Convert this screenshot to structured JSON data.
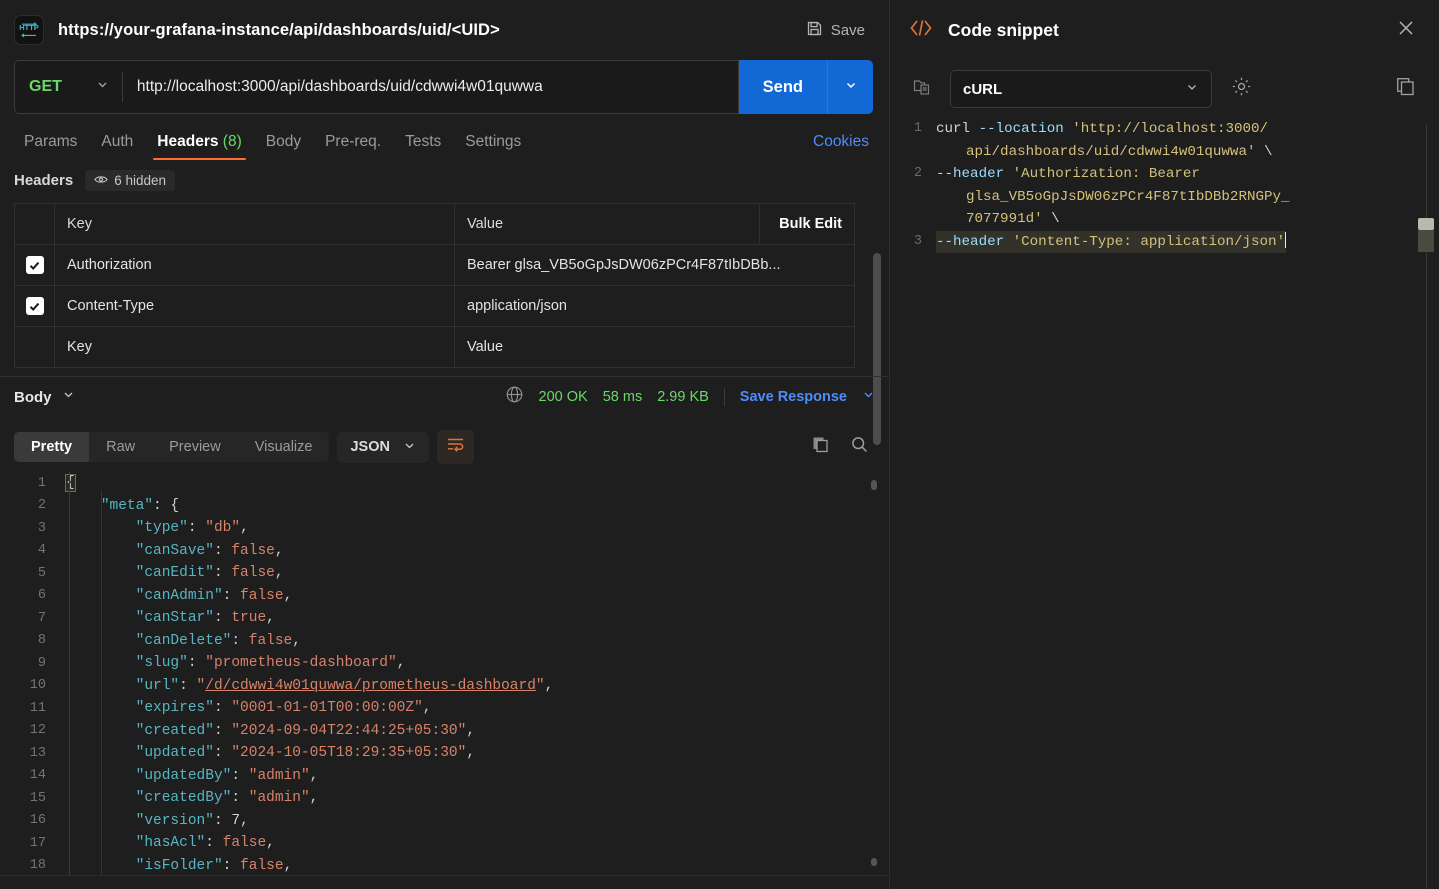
{
  "request": {
    "protocol_icon": "http-icon",
    "title": "https://your-grafana-instance/api/dashboards/uid/<UID>",
    "save_label": "Save",
    "method": "GET",
    "url": "http://localhost:3000/api/dashboards/uid/cdwwi4w01quwwa",
    "send_label": "Send"
  },
  "tabs": [
    {
      "label": "Params",
      "active": false
    },
    {
      "label": "Auth",
      "active": false
    },
    {
      "label": "Headers",
      "count": "(8)",
      "active": true
    },
    {
      "label": "Body",
      "active": false
    },
    {
      "label": "Pre-req.",
      "active": false
    },
    {
      "label": "Tests",
      "active": false
    },
    {
      "label": "Settings",
      "active": false
    }
  ],
  "cookies_label": "Cookies",
  "headers_section": {
    "label": "Headers",
    "hidden_label": "6 hidden",
    "columns": {
      "key": "Key",
      "value": "Value",
      "bulk_edit": "Bulk Edit"
    },
    "rows": [
      {
        "checked": true,
        "key": "Authorization",
        "value": "Bearer glsa_VB5oGpJsDW06zPCr4F87tIbDBb..."
      },
      {
        "checked": true,
        "key": "Content-Type",
        "value": "application/json"
      },
      {
        "checked": false,
        "key": "Key",
        "value": "Value",
        "placeholder": true
      }
    ]
  },
  "response": {
    "body_label": "Body",
    "status": "200 OK",
    "time": "58 ms",
    "size": "2.99 KB",
    "save_response_label": "Save Response",
    "view_tabs": [
      {
        "label": "Pretty",
        "active": true
      },
      {
        "label": "Raw",
        "active": false
      },
      {
        "label": "Preview",
        "active": false
      },
      {
        "label": "Visualize",
        "active": false
      }
    ],
    "format": "JSON",
    "json_lines": [
      {
        "n": "1",
        "segments": [
          {
            "t": "{",
            "c": "p",
            "box": true
          }
        ]
      },
      {
        "n": "2",
        "segments": [
          {
            "t": "    ",
            "c": "p"
          },
          {
            "t": "\"meta\"",
            "c": "k"
          },
          {
            "t": ": {",
            "c": "p"
          }
        ]
      },
      {
        "n": "3",
        "segments": [
          {
            "t": "        ",
            "c": "p"
          },
          {
            "t": "\"type\"",
            "c": "k"
          },
          {
            "t": ": ",
            "c": "p"
          },
          {
            "t": "\"db\"",
            "c": "s"
          },
          {
            "t": ",",
            "c": "p"
          }
        ]
      },
      {
        "n": "4",
        "segments": [
          {
            "t": "        ",
            "c": "p"
          },
          {
            "t": "\"canSave\"",
            "c": "k"
          },
          {
            "t": ": ",
            "c": "p"
          },
          {
            "t": "false",
            "c": "b"
          },
          {
            "t": ",",
            "c": "p"
          }
        ]
      },
      {
        "n": "5",
        "segments": [
          {
            "t": "        ",
            "c": "p"
          },
          {
            "t": "\"canEdit\"",
            "c": "k"
          },
          {
            "t": ": ",
            "c": "p"
          },
          {
            "t": "false",
            "c": "b"
          },
          {
            "t": ",",
            "c": "p"
          }
        ]
      },
      {
        "n": "6",
        "segments": [
          {
            "t": "        ",
            "c": "p"
          },
          {
            "t": "\"canAdmin\"",
            "c": "k"
          },
          {
            "t": ": ",
            "c": "p"
          },
          {
            "t": "false",
            "c": "b"
          },
          {
            "t": ",",
            "c": "p"
          }
        ]
      },
      {
        "n": "7",
        "segments": [
          {
            "t": "        ",
            "c": "p"
          },
          {
            "t": "\"canStar\"",
            "c": "k"
          },
          {
            "t": ": ",
            "c": "p"
          },
          {
            "t": "true",
            "c": "b"
          },
          {
            "t": ",",
            "c": "p"
          }
        ]
      },
      {
        "n": "8",
        "segments": [
          {
            "t": "        ",
            "c": "p"
          },
          {
            "t": "\"canDelete\"",
            "c": "k"
          },
          {
            "t": ": ",
            "c": "p"
          },
          {
            "t": "false",
            "c": "b"
          },
          {
            "t": ",",
            "c": "p"
          }
        ]
      },
      {
        "n": "9",
        "segments": [
          {
            "t": "        ",
            "c": "p"
          },
          {
            "t": "\"slug\"",
            "c": "k"
          },
          {
            "t": ": ",
            "c": "p"
          },
          {
            "t": "\"prometheus-dashboard\"",
            "c": "s"
          },
          {
            "t": ",",
            "c": "p"
          }
        ]
      },
      {
        "n": "10",
        "segments": [
          {
            "t": "        ",
            "c": "p"
          },
          {
            "t": "\"url\"",
            "c": "k"
          },
          {
            "t": ": ",
            "c": "p"
          },
          {
            "t": "\"",
            "c": "s"
          },
          {
            "t": "/d/cdwwi4w01quwwa/prometheus-dashboard",
            "c": "ulink"
          },
          {
            "t": "\"",
            "c": "s"
          },
          {
            "t": ",",
            "c": "p"
          }
        ]
      },
      {
        "n": "11",
        "segments": [
          {
            "t": "        ",
            "c": "p"
          },
          {
            "t": "\"expires\"",
            "c": "k"
          },
          {
            "t": ": ",
            "c": "p"
          },
          {
            "t": "\"0001-01-01T00:00:00Z\"",
            "c": "s"
          },
          {
            "t": ",",
            "c": "p"
          }
        ]
      },
      {
        "n": "12",
        "segments": [
          {
            "t": "        ",
            "c": "p"
          },
          {
            "t": "\"created\"",
            "c": "k"
          },
          {
            "t": ": ",
            "c": "p"
          },
          {
            "t": "\"2024-09-04T22:44:25+05:30\"",
            "c": "s"
          },
          {
            "t": ",",
            "c": "p"
          }
        ]
      },
      {
        "n": "13",
        "segments": [
          {
            "t": "        ",
            "c": "p"
          },
          {
            "t": "\"updated\"",
            "c": "k"
          },
          {
            "t": ": ",
            "c": "p"
          },
          {
            "t": "\"2024-10-05T18:29:35+05:30\"",
            "c": "s"
          },
          {
            "t": ",",
            "c": "p"
          }
        ]
      },
      {
        "n": "14",
        "segments": [
          {
            "t": "        ",
            "c": "p"
          },
          {
            "t": "\"updatedBy\"",
            "c": "k"
          },
          {
            "t": ": ",
            "c": "p"
          },
          {
            "t": "\"admin\"",
            "c": "s"
          },
          {
            "t": ",",
            "c": "p"
          }
        ]
      },
      {
        "n": "15",
        "segments": [
          {
            "t": "        ",
            "c": "p"
          },
          {
            "t": "\"createdBy\"",
            "c": "k"
          },
          {
            "t": ": ",
            "c": "p"
          },
          {
            "t": "\"admin\"",
            "c": "s"
          },
          {
            "t": ",",
            "c": "p"
          }
        ]
      },
      {
        "n": "16",
        "segments": [
          {
            "t": "        ",
            "c": "p"
          },
          {
            "t": "\"version\"",
            "c": "k"
          },
          {
            "t": ": ",
            "c": "p"
          },
          {
            "t": "7",
            "c": "n"
          },
          {
            "t": ",",
            "c": "p"
          }
        ]
      },
      {
        "n": "17",
        "segments": [
          {
            "t": "        ",
            "c": "p"
          },
          {
            "t": "\"hasAcl\"",
            "c": "k"
          },
          {
            "t": ": ",
            "c": "p"
          },
          {
            "t": "false",
            "c": "b"
          },
          {
            "t": ",",
            "c": "p"
          }
        ]
      },
      {
        "n": "18",
        "segments": [
          {
            "t": "        ",
            "c": "p"
          },
          {
            "t": "\"isFolder\"",
            "c": "k"
          },
          {
            "t": ": ",
            "c": "p"
          },
          {
            "t": "false",
            "c": "b"
          },
          {
            "t": ",",
            "c": "p"
          }
        ]
      }
    ]
  },
  "code_snippet": {
    "title": "Code snippet",
    "language": "cURL",
    "lines": [
      {
        "n": "1",
        "segments": [
          {
            "t": "curl ",
            "c": "sy-cmd"
          },
          {
            "t": "--location",
            "c": "sy-flag"
          },
          {
            "t": " ",
            "c": "sy-cmd"
          },
          {
            "t": "'http://localhost:3000/",
            "c": "sy-str"
          }
        ],
        "cont": [
          {
            "t": "api/dashboards/uid/cdwwi4w01quwwa'",
            "c": "sy-str"
          },
          {
            "t": " \\",
            "c": "sy-cont"
          }
        ]
      },
      {
        "n": "2",
        "segments": [
          {
            "t": "--header",
            "c": "sy-flag"
          },
          {
            "t": " ",
            "c": "sy-cmd"
          },
          {
            "t": "'Authorization: Bearer",
            "c": "sy-str"
          }
        ],
        "cont": [
          {
            "t": "glsa_VB5oGpJsDW06zPCr4F87tIbDBb2RNGPy_",
            "c": "sy-str"
          }
        ],
        "cont2": [
          {
            "t": "7077991d'",
            "c": "sy-str"
          },
          {
            "t": " \\",
            "c": "sy-cont"
          }
        ]
      },
      {
        "n": "3",
        "selected": true,
        "segments": [
          {
            "t": "--header",
            "c": "sy-flag"
          },
          {
            "t": " ",
            "c": "sy-cmd"
          },
          {
            "t": "'Content-Type: application/json'",
            "c": "sy-str"
          }
        ]
      }
    ],
    "raw_text": "curl --location 'http://localhost:3000/api/dashboards/uid/cdwwi4w01quwwa' \\\n--header 'Authorization: Bearer glsa_VB5oGpJsDW06zPCr4F87tIbDBb2RNGPy_7077991d' \\\n--header 'Content-Type: application/json'"
  },
  "colors": {
    "accent_orange": "#ff6c37",
    "send_blue": "#1268d4",
    "link_blue": "#4c8dfb",
    "status_green": "#6bd968",
    "method_green": "#6bd968",
    "background": "#1e1e1e"
  }
}
